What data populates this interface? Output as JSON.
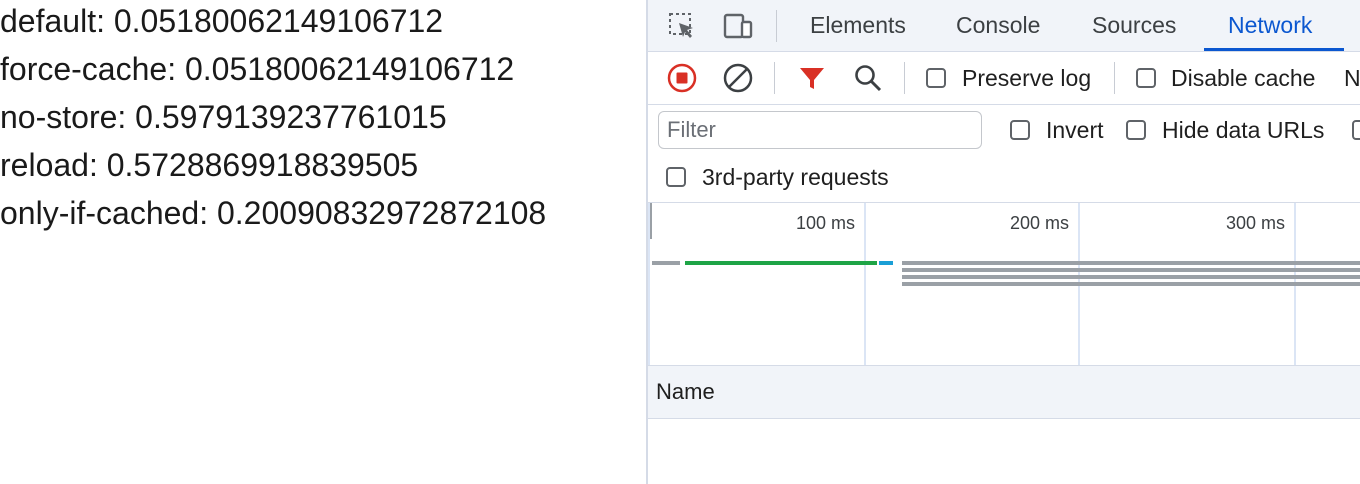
{
  "page_output": {
    "lines": [
      "default: 0.05180062149106712",
      "force-cache: 0.05180062149106712",
      "no-store: 0.5979139237761015",
      "reload: 0.5728869918839505",
      "only-if-cached: 0.20090832972872108"
    ]
  },
  "devtools": {
    "toolbar_icons": [
      "inspect-element-icon",
      "device-toolbar-icon"
    ],
    "tabs": [
      {
        "label": "Elements",
        "active": false
      },
      {
        "label": "Console",
        "active": false
      },
      {
        "label": "Sources",
        "active": false
      },
      {
        "label": "Network",
        "active": true
      }
    ],
    "network_toolbar": {
      "icons": [
        "record-icon",
        "clear-icon",
        "filter-icon",
        "search-icon"
      ],
      "preserve_log_label": "Preserve log",
      "preserve_log_checked": false,
      "disable_cache_label": "Disable cache",
      "disable_cache_checked": false,
      "overflow_text": "N"
    },
    "filter": {
      "placeholder": "Filter",
      "value": "",
      "invert_label": "Invert",
      "hide_data_urls_label": "Hide data URLs",
      "third_party_label": "3rd-party requests"
    },
    "overview": {
      "tick_labels": [
        "100 ms",
        "200 ms",
        "300 ms"
      ]
    },
    "request_list": {
      "columns": [
        "Name"
      ]
    }
  },
  "colors": {
    "accent": "#0b57d0",
    "record_red": "#d93025",
    "bar_green": "#1ea446",
    "bar_blue": "#1a9fd6",
    "bar_gray": "#9aa0a6"
  }
}
